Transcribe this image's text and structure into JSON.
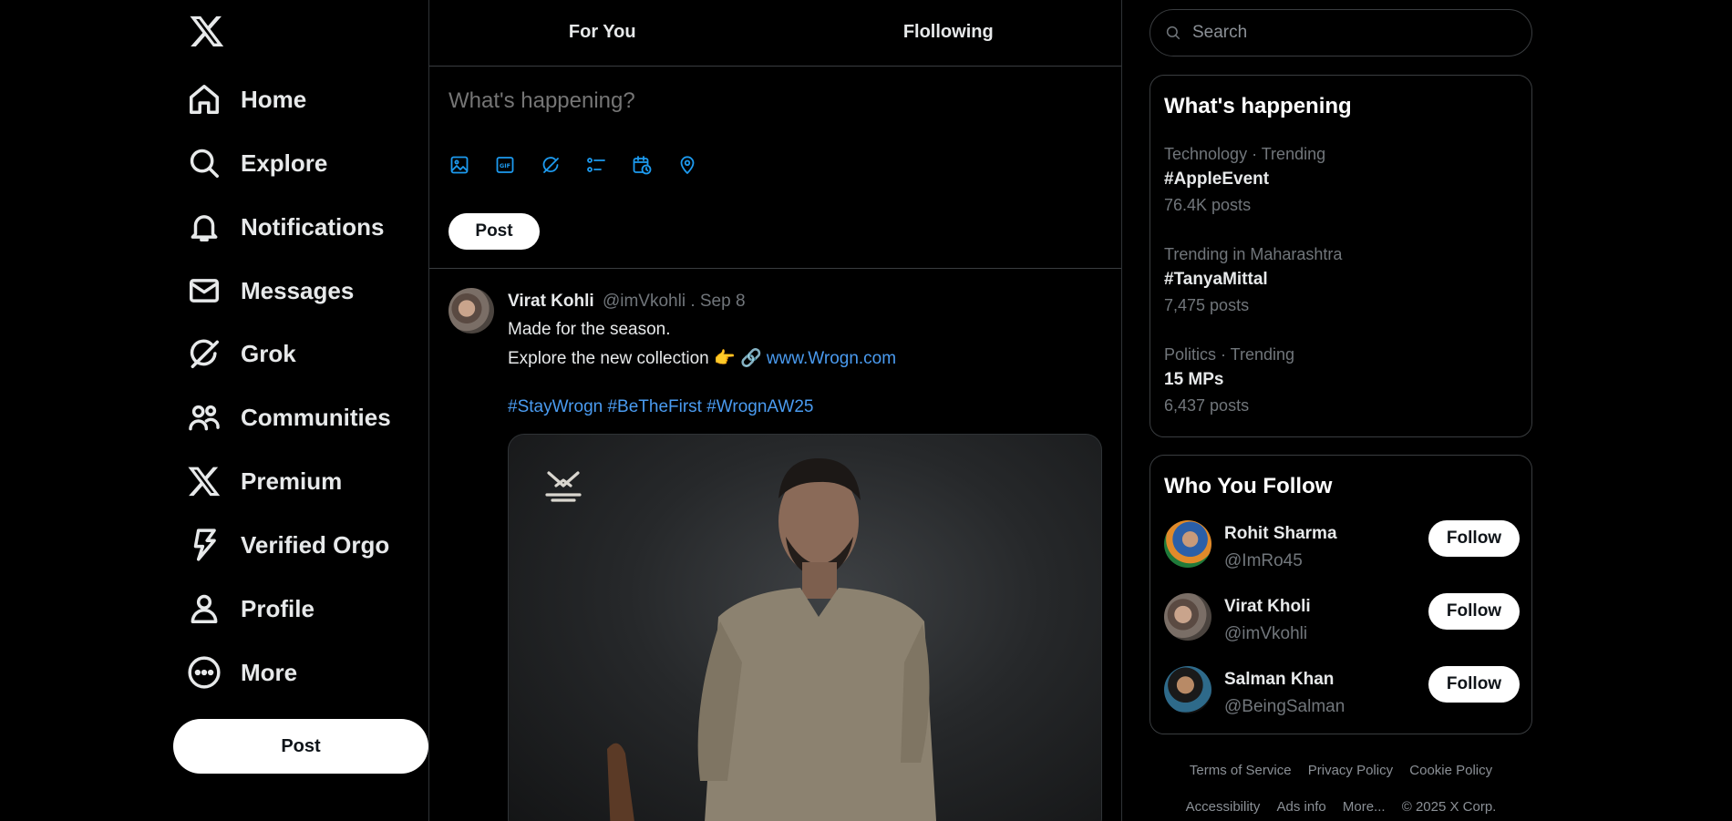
{
  "nav": {
    "items": [
      {
        "label": "Home",
        "icon": "home-icon"
      },
      {
        "label": "Explore",
        "icon": "search-icon"
      },
      {
        "label": "Notifications",
        "icon": "bell-icon"
      },
      {
        "label": "Messages",
        "icon": "mail-icon"
      },
      {
        "label": "Grok",
        "icon": "grok-icon"
      },
      {
        "label": "Communities",
        "icon": "people-icon"
      },
      {
        "label": "Premium",
        "icon": "x-logo-icon"
      },
      {
        "label": "Verified Orgo",
        "icon": "lightning-icon"
      },
      {
        "label": "Profile",
        "icon": "person-icon"
      },
      {
        "label": "More",
        "icon": "more-circle-icon"
      }
    ],
    "post_label": "Post"
  },
  "tabs": [
    {
      "label": "For You"
    },
    {
      "label": "Flollowing"
    }
  ],
  "composer": {
    "placeholder": "What's happening?",
    "post_label": "Post",
    "tools": [
      "image-icon",
      "gif-icon",
      "grok-icon",
      "poll-icon",
      "schedule-icon",
      "location-icon"
    ]
  },
  "tweet": {
    "name": "Virat Kohli",
    "meta": "@imVkohli . Sep 8",
    "line1": "Made for the season.",
    "line2_text": "Explore the new collection 👉 🔗 ",
    "line2_link": "www.Wrogn.com",
    "hashtags": "#StayWrogn #BeTheFirst #WrognAW25"
  },
  "search": {
    "placeholder": "Search"
  },
  "whats_happening": {
    "title": "What's happening",
    "trends": [
      {
        "context": "Technology · Trending",
        "tag": "#AppleEvent",
        "count": "76.4K posts"
      },
      {
        "context": "Trending in Maharashtra",
        "tag": "#TanyaMittal",
        "count": "7,475 posts"
      },
      {
        "context": "Politics · Trending",
        "tag": "15 MPs",
        "count": "6,437 posts"
      }
    ]
  },
  "who_to_follow": {
    "title": "Who You Follow",
    "users": [
      {
        "name": "Rohit Sharma",
        "handle": "@ImRo45",
        "button": "Follow"
      },
      {
        "name": "Virat Kholi",
        "handle": "@imVkohli",
        "button": "Follow"
      },
      {
        "name": "Salman Khan",
        "handle": "@BeingSalman",
        "button": "Follow"
      }
    ]
  },
  "footer": {
    "row1": [
      "Terms of Service",
      "Privacy Policy",
      "Cookie Policy"
    ],
    "row2": [
      "Accessibility",
      "Ads info",
      "More..."
    ],
    "copyright": "© 2025 X Corp."
  }
}
